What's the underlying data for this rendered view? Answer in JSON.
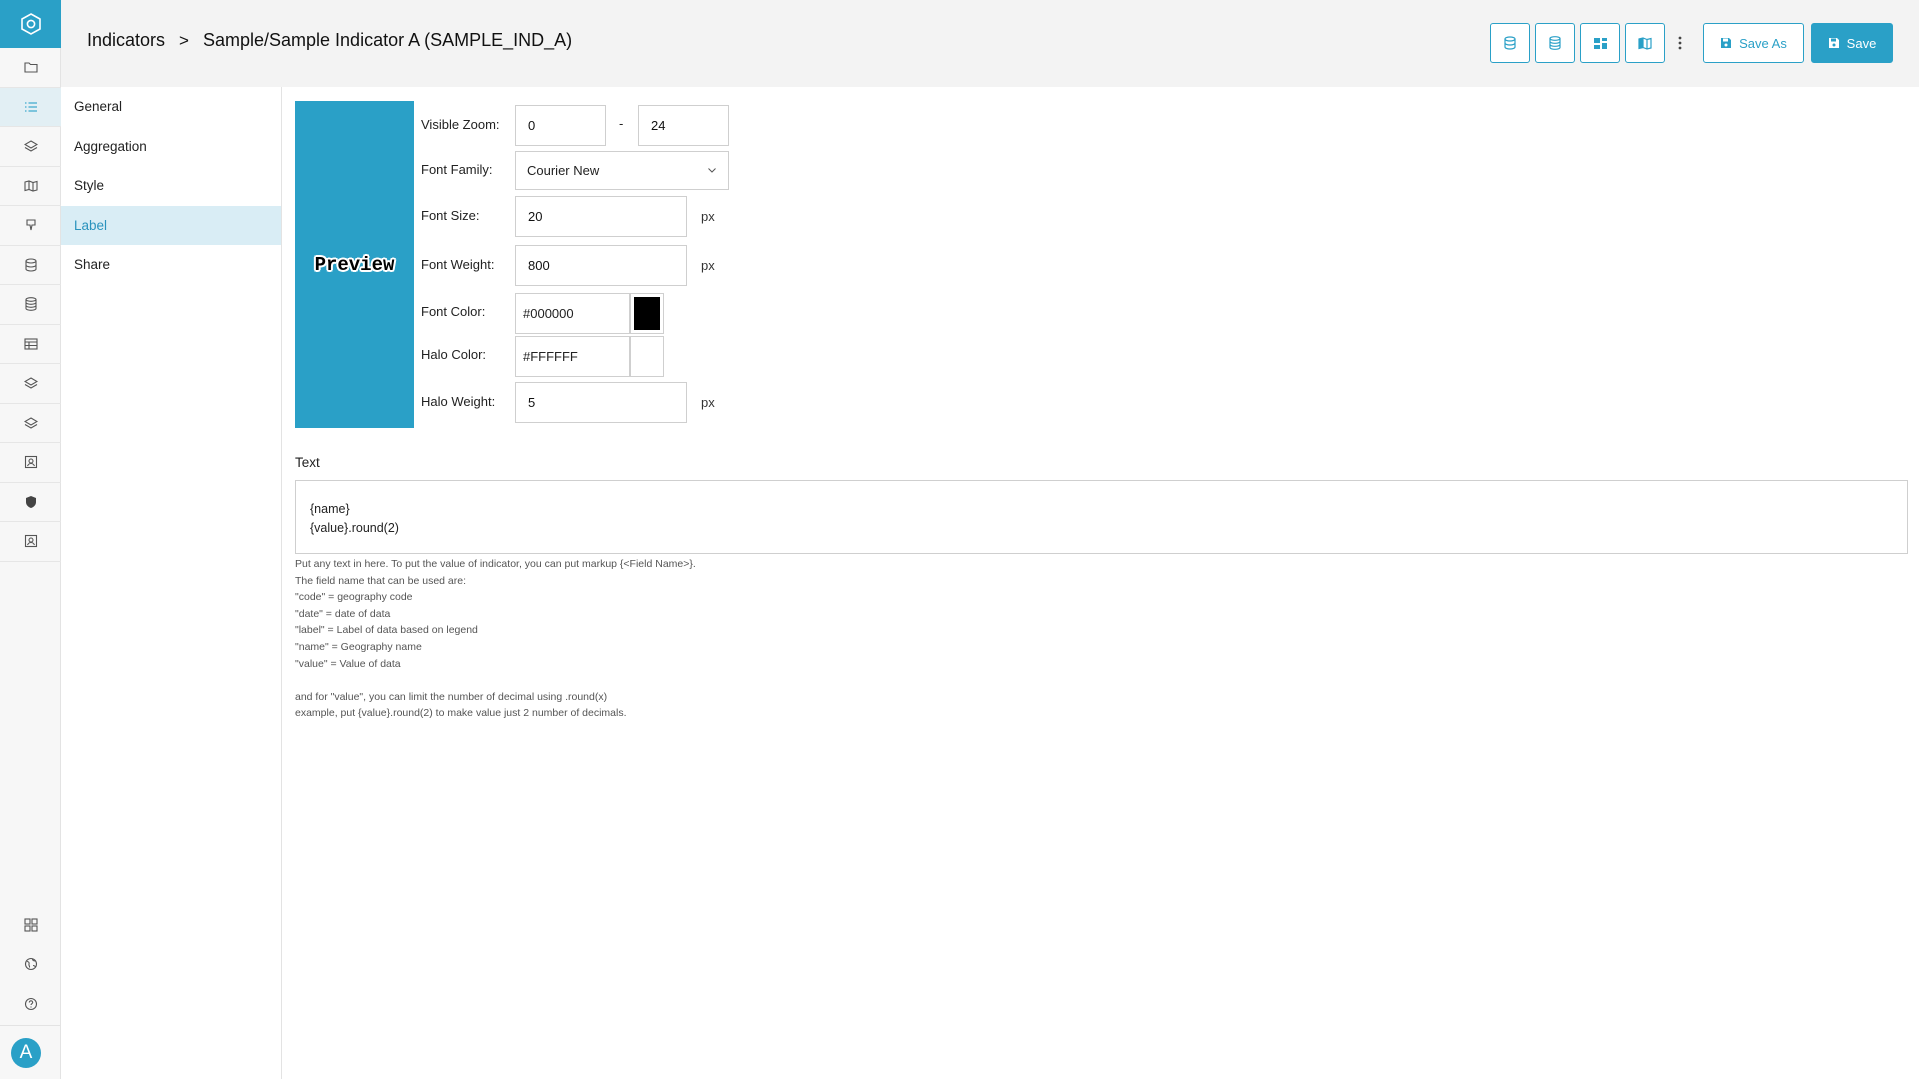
{
  "breadcrumb": {
    "root": "Indicators",
    "separator": ">",
    "current": "Sample/Sample Indicator A (SAMPLE_IND_A)"
  },
  "toolbar": {
    "icons": [
      "database-icon",
      "database-stack-icon",
      "dashboard-icon",
      "map-icon",
      "more-vertical-icon"
    ],
    "save_as_label": "Save As",
    "save_label": "Save"
  },
  "rail": {
    "icons": [
      "folder-icon",
      "list-icon",
      "layers-icon",
      "map-icon",
      "pin-icon",
      "database-icon",
      "database-stack-icon",
      "table-icon",
      "layers-icon",
      "layers-icon",
      "contact-icon",
      "shield-icon",
      "contact-icon"
    ],
    "bottom_icons": [
      "grid-icon",
      "globe-icon",
      "help-icon"
    ],
    "avatar": "A"
  },
  "secnav": {
    "items": [
      "General",
      "Aggregation",
      "Style",
      "Label",
      "Share"
    ],
    "active": "Label"
  },
  "preview": {
    "text": "Preview",
    "background": "#2aa0c7"
  },
  "form": {
    "visible_zoom_label": "Visible Zoom:",
    "zoom_min": "0",
    "zoom_separator": "-",
    "zoom_max": "24",
    "font_family_label": "Font Family:",
    "font_family_value": "Courier New",
    "font_size_label": "Font Size:",
    "font_size_value": "20",
    "font_weight_label": "Font Weight:",
    "font_weight_value": "800",
    "font_color_label": "Font Color:",
    "font_color_value": "#000000",
    "halo_color_label": "Halo Color:",
    "halo_color_value": "#FFFFFF",
    "halo_weight_label": "Halo Weight:",
    "halo_weight_value": "5",
    "unit_px": "px"
  },
  "text_section": {
    "title": "Text",
    "lines": [
      "{name}",
      "{value}.round(2)"
    ]
  },
  "help_lines": [
    "Put any text in here. To put the value of indicator, you can put markup {<Field Name>}.",
    "The field name that can be used are:",
    "\"code\" = geography code",
    "\"date\" = date of data",
    "\"label\" = Label of data based on legend",
    "\"name\" = Geography name",
    "\"value\" = Value of data",
    "",
    "and for \"value\", you can limit the number of decimal using .round(x)",
    "example, put {value}.round(2) to make value just 2 number of decimals."
  ],
  "colors": {
    "accent": "#2aa0c7",
    "active_nav_bg": "#d9edf5",
    "font_color_swatch": "#000000",
    "halo_color_swatch": "#FFFFFF"
  }
}
